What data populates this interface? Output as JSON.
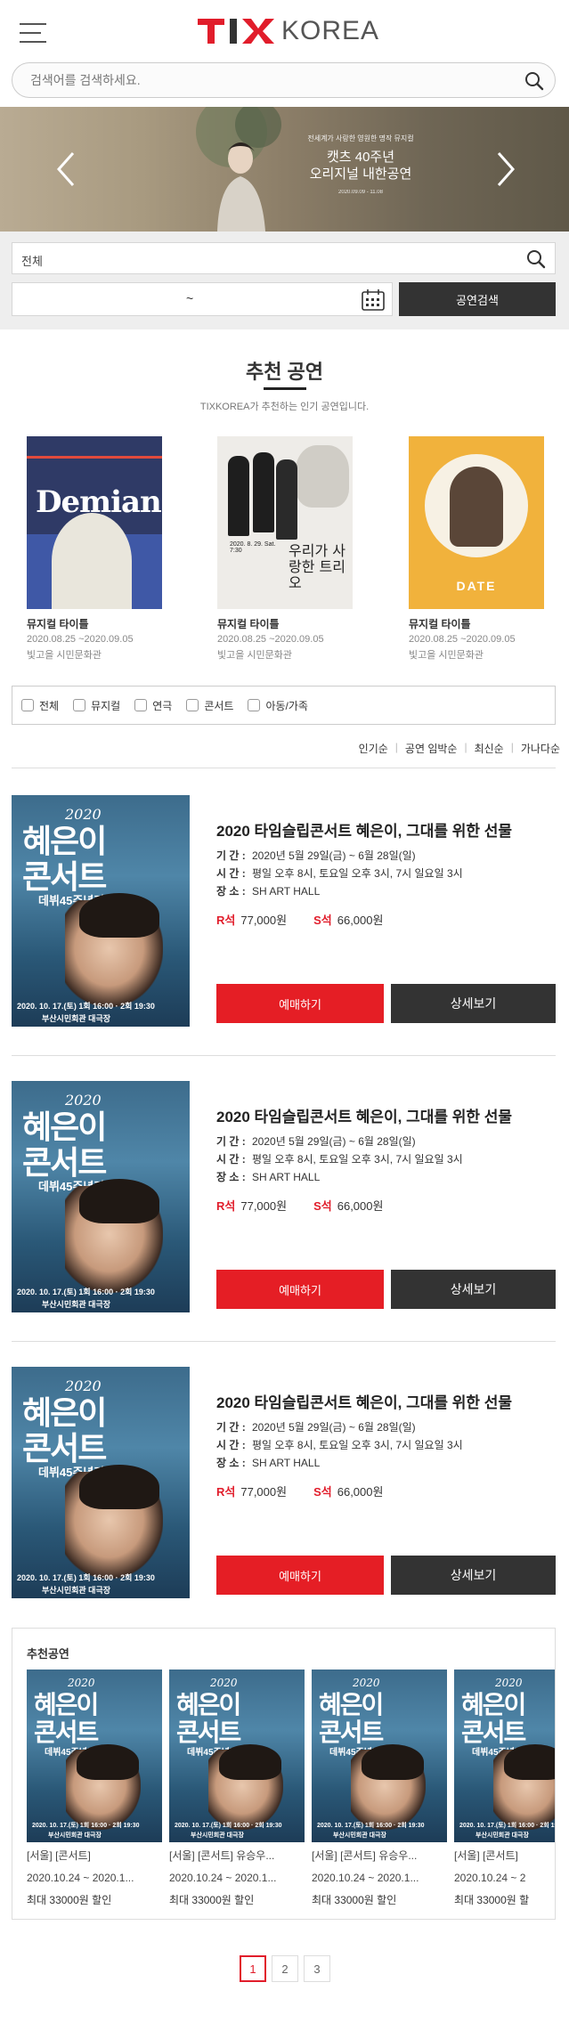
{
  "header": {
    "logo_tix": "TIX",
    "logo_korea": "KOREA"
  },
  "search": {
    "placeholder": "검색어를 검색하세요."
  },
  "banner": {
    "subtitle": "전세계가 사랑한 영원한 명작 뮤지컬",
    "title_line1": "캣츠 40주년",
    "title_line2": "오리지널 내한공연",
    "date": "2020.09.09 - 11.08"
  },
  "filter": {
    "category": "전체",
    "date_separator": "~",
    "search_button": "공연검색"
  },
  "recommended": {
    "title": "추천 공연",
    "description": "TIXKOREA가 추천하는 인기 공연입니다.",
    "items": [
      {
        "type": "뮤지컬 타이틀",
        "date": "2020.08.25 ~2020.09.05",
        "venue": "빛고을 시민문화관",
        "poster_text": "Demian"
      },
      {
        "type": "뮤지컬 타이틀",
        "date": "2020.08.25 ~2020.09.05",
        "venue": "빛고을 시민문화관",
        "poster_text": "우리가 사랑한 트리오",
        "poster_date": "2020. 8. 29. Sat. 7:30"
      },
      {
        "type": "뮤지컬 타이틀",
        "date": "2020.08.25 ~2020.09.05",
        "venue": "빛고을 시민문화관",
        "poster_text": "DATE"
      }
    ]
  },
  "genres": [
    "전체",
    "뮤지컬",
    "연극",
    "콘서트",
    "아동/가족"
  ],
  "sort": [
    "인기순",
    "공연 임박순",
    "최신순",
    "가나다순"
  ],
  "shows": [
    {
      "title": "2020 타임슬립콘서트 혜은이, 그대를 위한 선물",
      "period_label": "기 간 :",
      "period": "2020년 5월 29일(금) ~ 6월 28일(일)",
      "time_label": "시 간 :",
      "time": "평일 오후 8시, 토요일 오후 3시, 7시 일요일 3시",
      "place_label": "장 소 :",
      "place": "SH ART HALL",
      "r_grade": "R석",
      "r_price": "77,000원",
      "s_grade": "S석",
      "s_price": "66,000원",
      "book_label": "예매하기",
      "detail_label": "상세보기"
    },
    {
      "title": "2020 타임슬립콘서트 혜은이, 그대를 위한 선물",
      "period_label": "기 간 :",
      "period": "2020년 5월 29일(금) ~ 6월 28일(일)",
      "time_label": "시 간 :",
      "time": "평일 오후 8시, 토요일 오후 3시, 7시 일요일 3시",
      "place_label": "장 소 :",
      "place": "SH ART HALL",
      "r_grade": "R석",
      "r_price": "77,000원",
      "s_grade": "S석",
      "s_price": "66,000원",
      "book_label": "예매하기",
      "detail_label": "상세보기"
    },
    {
      "title": "2020 타임슬립콘서트 혜은이, 그대를 위한 선물",
      "period_label": "기 간 :",
      "period": "2020년 5월 29일(금) ~ 6월 28일(일)",
      "time_label": "시 간 :",
      "time": "평일 오후 8시, 토요일 오후 3시, 7시 일요일 3시",
      "place_label": "장 소 :",
      "place": "SH ART HALL",
      "r_grade": "R석",
      "r_price": "77,000원",
      "s_grade": "S석",
      "s_price": "66,000원",
      "book_label": "예매하기",
      "detail_label": "상세보기"
    }
  ],
  "poster": {
    "year": "2020",
    "title_line1": "혜은이",
    "title_line2": "콘서트",
    "subtitle": "데뷔45주년기념",
    "info": "2020. 10. 17.(토) 1회 16:00 · 2회 19:30",
    "venue": "부산시민회관 대극장"
  },
  "carousel": {
    "title": "추천공연",
    "items": [
      {
        "category": "[서울] [콘서트]",
        "date": "2020.10.24 ~ 2020.1...",
        "discount": "최대 33000원 할인"
      },
      {
        "category": "[서울] [콘서트] 유승우...",
        "date": "2020.10.24 ~ 2020.1...",
        "discount": "최대 33000원 할인"
      },
      {
        "category": "[서울] [콘서트] 유승우...",
        "date": "2020.10.24 ~ 2020.1...",
        "discount": "최대 33000원 할인"
      },
      {
        "category": "[서울] [콘서트]",
        "date": "2020.10.24 ~ 2",
        "discount": "최대 33000원 할"
      }
    ]
  },
  "pagination": [
    "1",
    "2",
    "3"
  ],
  "colors": {
    "brand_red": "#e11d2b",
    "book_red": "#e51e25",
    "dark_button": "#333333"
  }
}
